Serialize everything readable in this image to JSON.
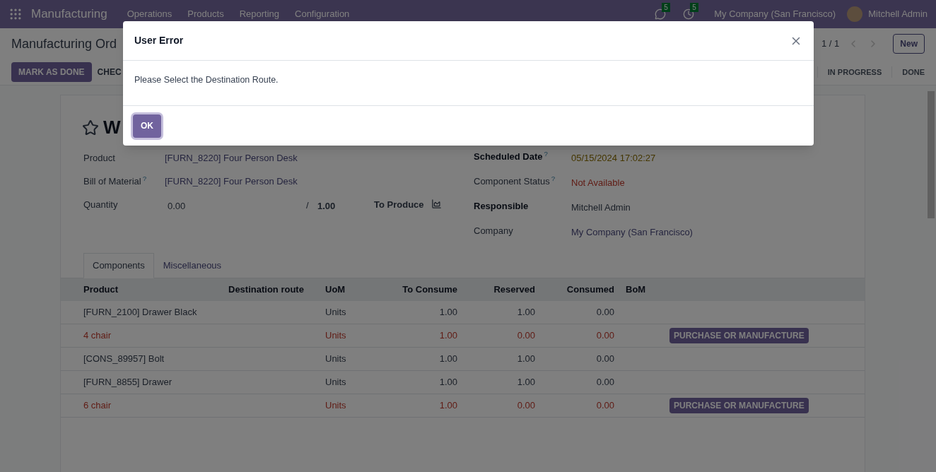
{
  "navbar": {
    "app_name": "Manufacturing",
    "menu": [
      "Operations",
      "Products",
      "Reporting",
      "Configuration"
    ],
    "messages_count": "5",
    "activities_count": "5",
    "company": "My Company (San Francisco)",
    "user": "Mitchell Admin"
  },
  "control_panel": {
    "breadcrumb": "Manufacturing Ord",
    "pager": "1 / 1",
    "new_button": "New",
    "actions": [
      {
        "label": "MARK AS DONE",
        "primary": true
      },
      {
        "label": "CHEC",
        "primary": false
      }
    ],
    "stages": [
      "IN PROGRESS",
      "DONE"
    ]
  },
  "form": {
    "title": "W",
    "starred": false,
    "left_fields": [
      {
        "label": "Product",
        "value": "[FURN_8220] Four Person Desk"
      },
      {
        "label": "Bill of Material",
        "tooltip": "?",
        "value": "[FURN_8220] Four Person Desk"
      }
    ],
    "quantity": {
      "label": "Quantity",
      "produced": "0.00",
      "separator": "/",
      "target": "1.00",
      "unit_label": "To Produce"
    },
    "right_fields": [
      {
        "label": "Scheduled Date",
        "tooltip": "?",
        "required": true,
        "value": "05/15/2024 17:02:27",
        "kind": "warning"
      },
      {
        "label": "Component Status",
        "tooltip": "?",
        "required": false,
        "value": "Not Available",
        "kind": "danger"
      },
      {
        "label": "Responsible",
        "required": true,
        "value": "Mitchell Admin",
        "kind": "plain"
      },
      {
        "label": "Company",
        "required": false,
        "value": "My Company (San Francisco)",
        "kind": "link"
      }
    ],
    "tabs": [
      {
        "label": "Components",
        "selected": true
      },
      {
        "label": "Miscellaneous",
        "selected": false
      }
    ]
  },
  "table": {
    "columns": [
      "Product",
      "Destination route",
      "UoM",
      "To Consume",
      "Reserved",
      "Consumed",
      "BoM"
    ],
    "rows": [
      {
        "product": "[FURN_2100] Drawer Black",
        "uom": "Units",
        "to_consume": "1.00",
        "reserved": "1.00",
        "consumed": "0.00",
        "unavailable": false
      },
      {
        "product": "4 chair",
        "uom": "Units",
        "to_consume": "1.00",
        "reserved": "0.00",
        "consumed": "0.00",
        "unavailable": true,
        "action": "PURCHASE OR MANUFACTURE"
      },
      {
        "product": "[CONS_89957] Bolt",
        "uom": "Units",
        "to_consume": "1.00",
        "reserved": "1.00",
        "consumed": "0.00",
        "unavailable": false
      },
      {
        "product": "[FURN_8855] Drawer",
        "uom": "Units",
        "to_consume": "1.00",
        "reserved": "1.00",
        "consumed": "0.00",
        "unavailable": false
      },
      {
        "product": "6 chair",
        "uom": "Units",
        "to_consume": "1.00",
        "reserved": "0.00",
        "consumed": "0.00",
        "unavailable": true,
        "action": "PURCHASE OR MANUFACTURE"
      }
    ]
  },
  "dialog": {
    "title": "User Error",
    "message": "Please Select the Destination Route.",
    "ok_button": "OK"
  }
}
